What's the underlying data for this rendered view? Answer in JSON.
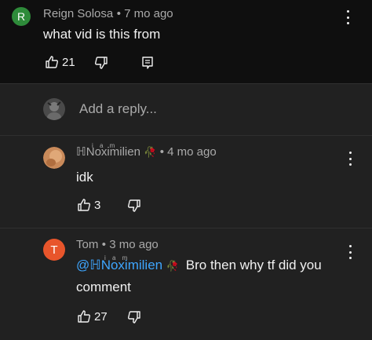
{
  "parent_comment": {
    "avatar_letter": "R",
    "author": "Reign Solosa",
    "time": "• 7 mo ago",
    "text": "what vid is this from",
    "likes": "21",
    "avatar_color": "#2e8b3a"
  },
  "reply_box": {
    "placeholder": "Add a reply..."
  },
  "replies": [
    {
      "author": "ℍNoximilien",
      "author_sup": "i  a m",
      "time": "• 4 mo ago",
      "text": "idk",
      "likes": "3"
    },
    {
      "avatar_letter": "T",
      "author": "Tom",
      "time": "• 3 mo ago",
      "mention": "@ℍNoximilien",
      "mention_sup": "i  a m",
      "text_line1": "Bro then why tf did you",
      "text_line2": "comment",
      "likes": "27",
      "avatar_color": "#e8552b"
    }
  ],
  "rose_glyph": "🥀"
}
